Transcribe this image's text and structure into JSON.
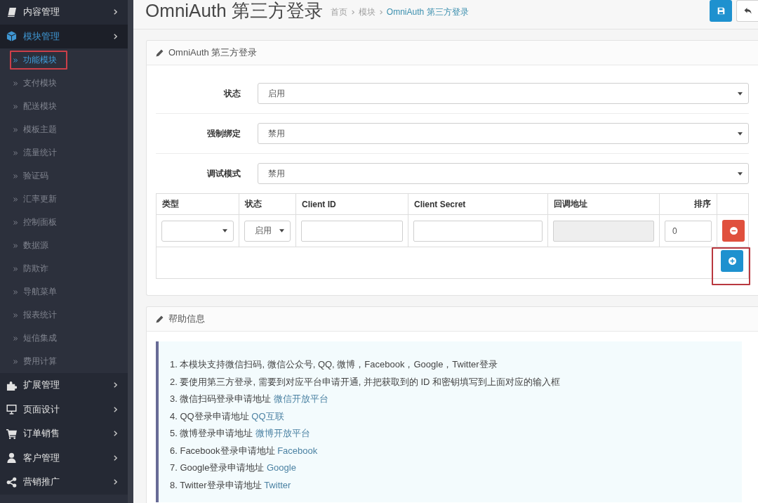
{
  "sidebar": {
    "items": [
      {
        "label": "内容管理",
        "selected": false
      },
      {
        "label": "模块管理",
        "selected": true,
        "children": [
          {
            "label": "功能模块",
            "selected": true,
            "highlighted": true
          },
          {
            "label": "支付模块",
            "selected": false,
            "highlighted": false
          },
          {
            "label": "配送模块",
            "selected": false,
            "highlighted": false
          },
          {
            "label": "模板主题",
            "selected": false,
            "highlighted": false
          },
          {
            "label": "流量统计",
            "selected": false,
            "highlighted": false
          },
          {
            "label": "验证码",
            "selected": false,
            "highlighted": false
          },
          {
            "label": "汇率更新",
            "selected": false,
            "highlighted": false
          },
          {
            "label": "控制面板",
            "selected": false,
            "highlighted": false
          },
          {
            "label": "数据源",
            "selected": false,
            "highlighted": false
          },
          {
            "label": "防欺诈",
            "selected": false,
            "highlighted": false
          },
          {
            "label": "导航菜单",
            "selected": false,
            "highlighted": false
          },
          {
            "label": "报表统计",
            "selected": false,
            "highlighted": false
          },
          {
            "label": "短信集成",
            "selected": false,
            "highlighted": false
          },
          {
            "label": "费用计算",
            "selected": false,
            "highlighted": false
          }
        ]
      },
      {
        "label": "扩展管理",
        "selected": false
      },
      {
        "label": "页面设计",
        "selected": false
      },
      {
        "label": "订单销售",
        "selected": false
      },
      {
        "label": "客户管理",
        "selected": false
      },
      {
        "label": "营销推广",
        "selected": false
      }
    ]
  },
  "header": {
    "title": "OmniAuth 第三方登录",
    "breadcrumb": [
      {
        "label": "首页",
        "selected": false
      },
      {
        "label": "模块",
        "selected": false
      },
      {
        "label": "OmniAuth 第三方登录",
        "selected": true
      }
    ],
    "buttons": [
      {
        "kind": "save"
      },
      {
        "kind": "back"
      }
    ]
  },
  "settings_panel": {
    "title": "OmniAuth 第三方登录",
    "fields": [
      {
        "label": "状态",
        "value": "启用"
      },
      {
        "label": "强制绑定",
        "value": "禁用"
      },
      {
        "label": "调试模式",
        "value": "禁用"
      }
    ],
    "table": {
      "columns": [
        "类型",
        "状态",
        "Client ID",
        "Client Secret",
        "回调地址",
        "排序"
      ],
      "rows": [
        {
          "cells": [
            {
              "kind": "select",
              "disabled": false
            },
            {
              "kind": "select",
              "value": "启用",
              "disabled": false
            },
            {
              "kind": "input",
              "disabled": false
            },
            {
              "kind": "input",
              "disabled": false
            },
            {
              "kind": "input",
              "disabled": true
            },
            {
              "kind": "input",
              "value": "0",
              "disabled": false
            },
            {
              "kind": "remove_button"
            }
          ]
        }
      ],
      "add_button": {
        "highlighted": true
      }
    }
  },
  "help_panel": {
    "title": "帮助信息",
    "items": [
      {
        "text": "1. 本模块支持微信扫码, 微信公众号, QQ, 微博，Facebook，Google，Twitter登录"
      },
      {
        "text": "2. 要使用第三方登录, 需要到对应平台申请开通, 并把获取到的 ID 和密钥填写到上面对应的输入框"
      },
      {
        "text": "3. 微信扫码登录申请地址",
        "link": "微信开放平台"
      },
      {
        "text": "4. QQ登录申请地址",
        "link": "QQ互联"
      },
      {
        "text": "5. 微博登录申请地址",
        "link": "微博开放平台"
      },
      {
        "text": "6. Facebook登录申请地址",
        "link": "Facebook"
      },
      {
        "text": "7. Google登录申请地址",
        "link": "Google"
      },
      {
        "text": "8. Twitter登录申请地址",
        "link": "Twitter"
      }
    ]
  }
}
